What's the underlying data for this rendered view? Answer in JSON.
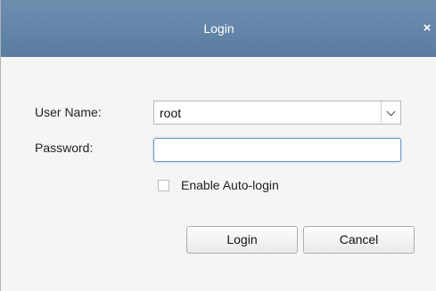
{
  "window": {
    "title": "Login",
    "close_icon": "close-icon",
    "close_glyph": "×"
  },
  "form": {
    "username_label": "User Name:",
    "username_value": "root",
    "password_label": "Password:",
    "password_value": "",
    "auto_login_label": "Enable Auto-login",
    "auto_login_checked": false
  },
  "buttons": {
    "login": "Login",
    "cancel": "Cancel"
  },
  "colors": {
    "titlebar": "#5f82a6",
    "focus_border": "#6a96c9"
  }
}
